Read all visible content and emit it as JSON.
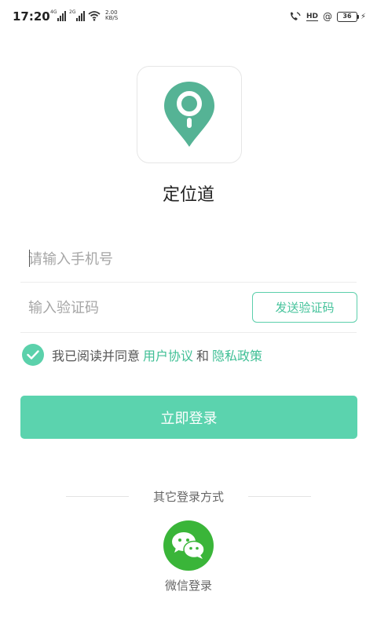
{
  "status_bar": {
    "time": "17:20",
    "sim1_tag": "4G",
    "sim2_tag": "2G",
    "speed_value": "2.00",
    "speed_unit": "KB/S",
    "hd_label": "HD",
    "battery_level": "36"
  },
  "app": {
    "name": "定位道",
    "brand_color": "#5ccfab",
    "logo_icon": "map-pin-icon"
  },
  "form": {
    "phone_placeholder": "请输入手机号",
    "phone_value": "",
    "code_placeholder": "输入验证码",
    "code_value": "",
    "send_code_label": "发送验证码"
  },
  "agreement": {
    "checked": true,
    "prefix": "我已阅读并同意",
    "user_agreement": "用户协议",
    "conjunction": "和",
    "privacy_policy": "隐私政策"
  },
  "login_button_label": "立即登录",
  "other_login": {
    "label": "其它登录方式",
    "wechat_label": "微信登录",
    "wechat_color": "#3ab539"
  }
}
